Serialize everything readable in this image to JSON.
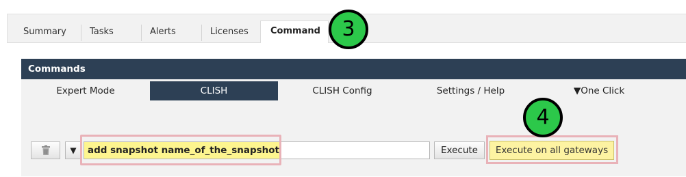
{
  "tabs": [
    {
      "label": "Summary"
    },
    {
      "label": "Tasks"
    },
    {
      "label": "Alerts"
    },
    {
      "label": "Licenses"
    },
    {
      "label": "Command"
    }
  ],
  "active_tab": "Command",
  "commands": {
    "header": "Commands",
    "subtabs": [
      {
        "label": "Expert Mode"
      },
      {
        "label": "CLISH"
      },
      {
        "label": "CLISH Config"
      },
      {
        "label": "Settings / Help"
      },
      {
        "label": "▼One Click"
      }
    ],
    "active_subtab": "CLISH"
  },
  "command_bar": {
    "clear_icon": "trash-icon",
    "dropdown_glyph": "▼",
    "input_value": "add snapshot name_of_the_snapshot",
    "execute_label": "Execute",
    "execute_all_label": "Execute on all gateways"
  },
  "annotations": {
    "step_tab": "3",
    "step_button": "4"
  },
  "colors": {
    "header_bg": "#2d4055",
    "highlight_border": "#e9b2b8",
    "highlight_fill": "#fdf58f",
    "badge_green": "#2cc84a"
  }
}
